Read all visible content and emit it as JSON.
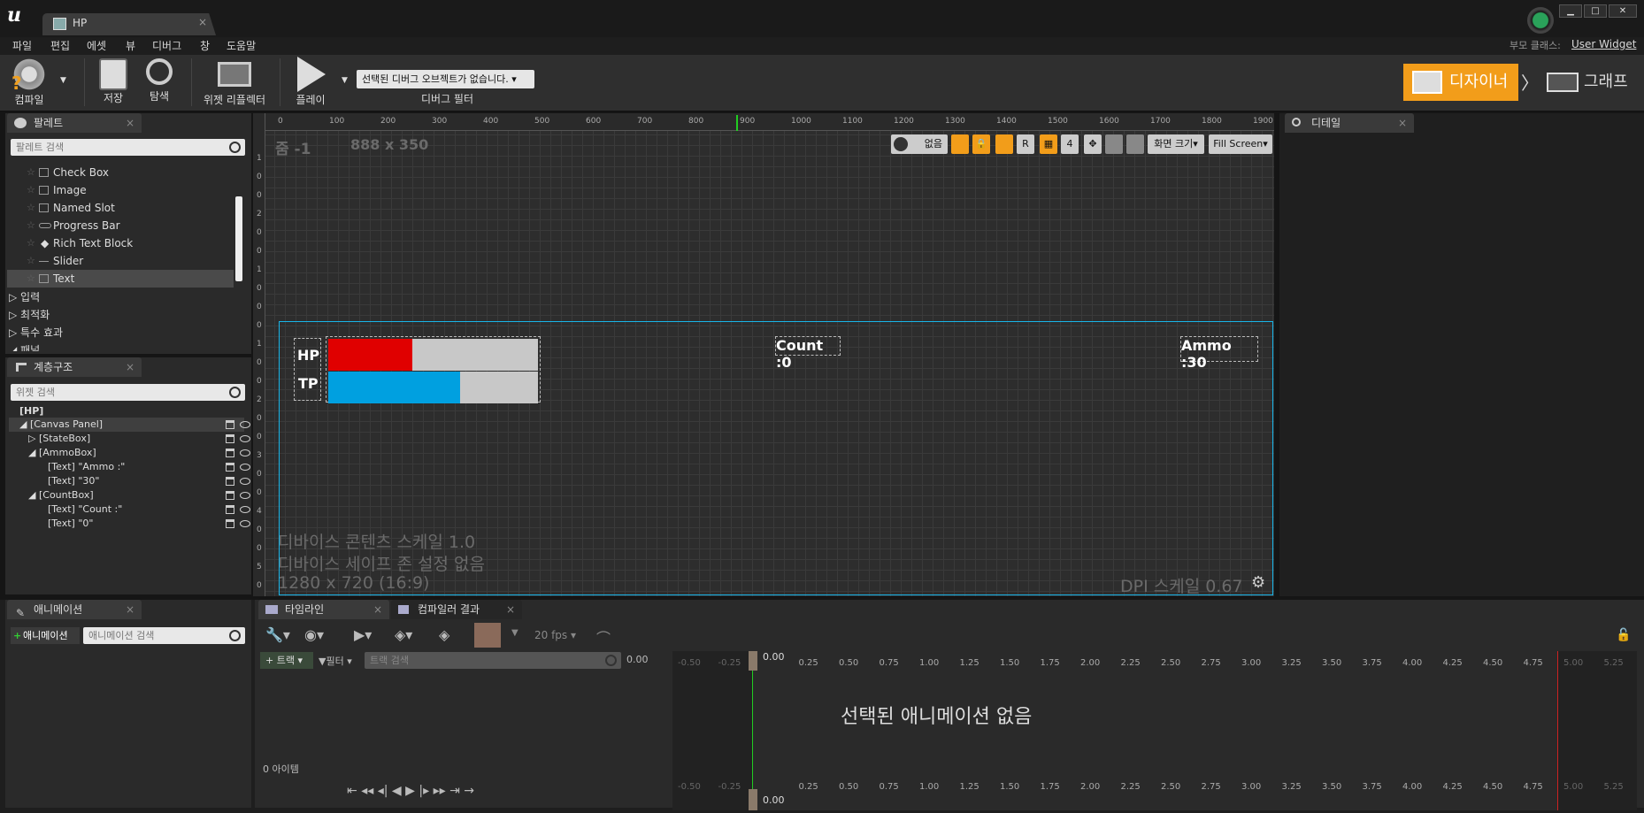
{
  "window": {
    "tab_title": "HP",
    "parent_class_label": "부모 클래스:",
    "parent_class_value": "User Widget"
  },
  "menu": [
    "파일",
    "편집",
    "에셋",
    "뷰",
    "디버그",
    "창",
    "도움말"
  ],
  "toolbar": {
    "compile": "컴파일",
    "save": "저장",
    "browse": "탐색",
    "reflector": "위젯 리플렉터",
    "play": "플레이",
    "debug_select": "선택된 디버그 오브젝트가 없습니다.",
    "debug_filter": "디버그 필터",
    "designer": "디자이너",
    "graph": "그래프"
  },
  "palette": {
    "tab": "팔레트",
    "search_placeholder": "팔레트 검색",
    "items": [
      "Check Box",
      "Image",
      "Named Slot",
      "Progress Bar",
      "Rich Text Block",
      "Slider",
      "Text"
    ],
    "categories": [
      "입력",
      "최적화",
      "특수 효과",
      "패널"
    ]
  },
  "hierarchy": {
    "tab": "계층구조",
    "search_placeholder": "위젯 검색",
    "items": [
      "[HP]",
      "[Canvas Panel]",
      "[StateBox]",
      "[AmmoBox]",
      "[Text] \"Ammo :\"",
      "[Text] \"30\"",
      "[CountBox]",
      "[Text] \"Count :\"",
      "[Text] \"0\""
    ]
  },
  "details": {
    "tab": "디테일"
  },
  "canvas": {
    "zoom": "줌 -1",
    "size": "888 x 350",
    "none_btn": "없음",
    "r_btn": "R",
    "grid_num": "4",
    "screen_size": "화면 크기",
    "fill_screen": "Fill Screen",
    "device_scale": "디바이스 콘텐츠 스케일 1.0",
    "safe_zone": "디바이스 세이프 존 설정 없음",
    "resolution": "1280 x 720 (16:9)",
    "dpi": "DPI 스케일 0.67",
    "ruler_x": [
      "0",
      "100",
      "200",
      "300",
      "400",
      "500",
      "600",
      "700",
      "800",
      "900",
      "1000",
      "1100",
      "1200",
      "1300",
      "1400",
      "1500",
      "1600",
      "1700",
      "1800",
      "1900"
    ],
    "ruler_y": [
      "1",
      "0",
      "0",
      "2",
      "0",
      "0",
      "1",
      "0",
      "0",
      "0",
      "1",
      "0",
      "0",
      "2",
      "0",
      "0",
      "3",
      "0",
      "0",
      "4",
      "0",
      "0",
      "5",
      "0",
      "0"
    ],
    "hp_label": "HP",
    "tp_label": "TP",
    "hp_percent": 40,
    "tp_percent": 63,
    "count_text": "Count :0",
    "ammo_text": "Ammo :30"
  },
  "animation": {
    "tab": "애니메이션",
    "add_btn": "애니메이션",
    "search_placeholder": "애니메이션 검색"
  },
  "timeline": {
    "tab": "타임라인",
    "compiler_tab": "컴파일러 결과",
    "fps": "20 fps",
    "track_btn": "트랙",
    "filter_btn": "필터",
    "track_search": "트랙 검색",
    "time_value": "0.00",
    "no_animation": "선택된 애니메이션 없음",
    "item_count": "0 아이템",
    "ticks": [
      "-0.50",
      "-0.25",
      "0.00",
      "0.25",
      "0.50",
      "0.75",
      "1.00",
      "1.25",
      "1.50",
      "1.75",
      "2.00",
      "2.25",
      "2.50",
      "2.75",
      "3.00",
      "3.25",
      "3.50",
      "3.75",
      "4.00",
      "4.25",
      "4.50",
      "4.75",
      "5.00",
      "5.25"
    ]
  },
  "colors": {
    "accent": "#f29d1a",
    "hp_bar": "#e00000",
    "tp_bar": "#00a0e0",
    "selection": "#19b4e8"
  }
}
